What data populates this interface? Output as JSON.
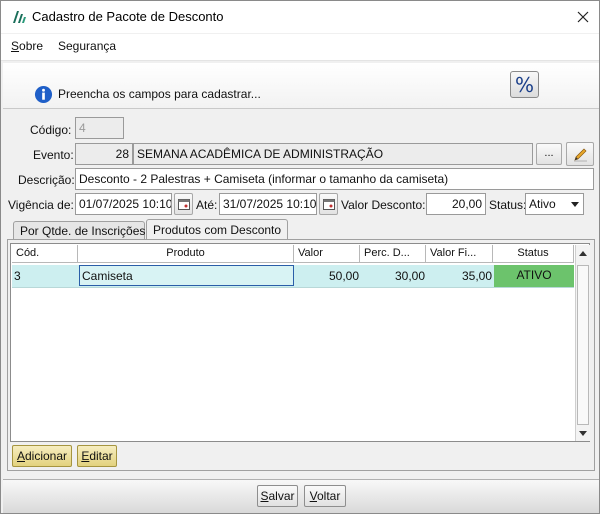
{
  "window": {
    "title": "Cadastro de Pacote de Desconto",
    "close_glyph": "✕"
  },
  "menu": {
    "items": [
      {
        "prefix": "S",
        "rest": "obre"
      },
      {
        "prefix": "",
        "rest": "Segurança"
      }
    ]
  },
  "banner": {
    "text": "Preencha os campos para cadastrar...",
    "action_glyph": "%"
  },
  "form": {
    "codigo_label": "Código:",
    "codigo_value": "4",
    "evento_label": "Evento:",
    "evento_id": "28",
    "evento_name": "SEMANA ACADÊMICA DE ADMINISTRAÇÃO",
    "evento_lookup_glyph": "...",
    "descricao_label": "Descrição:",
    "descricao_value": "Desconto - 2 Palestras + Camiseta (informar o tamanho da camiseta)",
    "vigencia_label": "Vigência de:",
    "vigencia_start": "01/07/2025 10:10",
    "ate_label": "Até:",
    "vigencia_end": "31/07/2025 10:10",
    "valor_label": "Valor Desconto:",
    "valor_value": "20,00",
    "status_label": "Status:",
    "status_value": "Ativo"
  },
  "tabs": [
    {
      "label": "Por Qtde. de Inscrições"
    },
    {
      "label": "Produtos com Desconto"
    }
  ],
  "grid": {
    "columns": [
      "Cód.",
      "Produto",
      "Valor",
      "Perc. D...",
      "Valor Fi...",
      "Status"
    ],
    "rows": [
      {
        "cod": "3",
        "produto": "Camiseta",
        "valor": "50,00",
        "perc": "30,00",
        "valor_final": "35,00",
        "status": "ATIVO"
      }
    ]
  },
  "panel_buttons": {
    "add_first": "A",
    "add_rest": "dicionar",
    "edit_first": "E",
    "edit_rest": "ditar"
  },
  "footer": {
    "save_first": "S",
    "save_rest": "alvar",
    "back_first": "V",
    "back_rest": "oltar"
  },
  "colors": {
    "selected_row": "#cdeff0",
    "status_active": "#6cc36c",
    "gold_button": "#e8d890"
  }
}
